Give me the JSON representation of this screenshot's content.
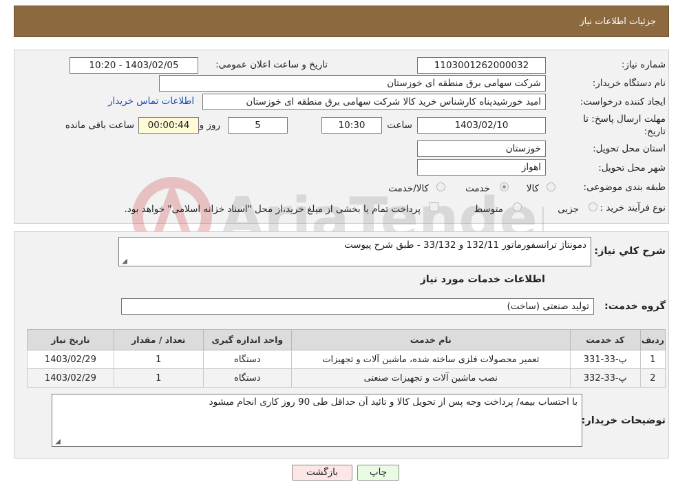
{
  "header": {
    "title": "جزئیات اطلاعات نیاز"
  },
  "info": {
    "need_number_label": "شماره نیاز:",
    "need_number": "1103001262000032",
    "announce_label": "تاریخ و ساعت اعلان عمومی:",
    "announce_value": "1403/02/05 - 10:20",
    "buyer_org_label": "نام دستگاه خریدار:",
    "buyer_org": "شرکت سهامی برق منطقه ای خوزستان",
    "requester_label": "ایجاد کننده درخواست:",
    "requester": "امید خورشیدپناه کارشناس خرید کالا شرکت سهامی برق منطقه ای خوزستان",
    "contact_link": "اطلاعات تماس خریدار",
    "deadline_label_1": "مهلت ارسال پاسخ: تا",
    "deadline_label_2": "تاریخ:",
    "deadline_date": "1403/02/10",
    "hour_label": "ساعت",
    "deadline_time": "10:30",
    "days_value": "5",
    "days_label": "روز و",
    "remaining_time": "00:00:44",
    "remaining_label": "ساعت باقی مانده",
    "province_label": "استان محل تحویل:",
    "province": "خوزستان",
    "city_label": "شهر محل تحویل:",
    "city": "اهواز",
    "category_label": "طبقه بندی موضوعی:",
    "category_options": [
      "کالا",
      "خدمت",
      "کالا/خدمت"
    ],
    "category_selected": "خدمت",
    "process_label": "نوع فرآیند خرید :",
    "process_options": [
      "جزیی",
      "متوسط"
    ],
    "payment_note": "پرداخت تمام یا بخشی از مبلغ خرید،از محل \"اسناد خزانه اسلامی\" خواهد بود."
  },
  "details": {
    "summary_label": "شرح کلي نياز:",
    "summary": "دمونتاژ ترانسفورماتور 132/11 و 33/132 - طبق شرح پیوست",
    "services_heading": "اطلاعات خدمات مورد نیاز",
    "group_label": "گروه خدمت:",
    "group_value": "تولید صنعتی (ساخت)",
    "table": {
      "headers": [
        "ردیف",
        "کد خدمت",
        "نام خدمت",
        "واحد اندازه گیری",
        "تعداد / مقدار",
        "تاریخ نیاز"
      ],
      "rows": [
        [
          "1",
          "پ-33-331",
          "تعمیر محصولات فلزی ساخته شده، ماشین آلات و تجهیزات",
          "دستگاه",
          "1",
          "1403/02/29"
        ],
        [
          "2",
          "پ-33-332",
          "نصب ماشین آلات و تجهیزات صنعتی",
          "دستگاه",
          "1",
          "1403/02/29"
        ]
      ]
    },
    "buyer_notes_label": "توضیحات خریدار:",
    "buyer_notes": "با احتساب بیمه/ پرداخت وجه پس از تحویل کالا و تائید آن حداقل طی 90 روز کاری انجام میشود"
  },
  "buttons": {
    "print": "چاپ",
    "back": "بازگشت"
  },
  "colors": {
    "header": "#8b6a3f",
    "print_btn": "#eafbe4",
    "back_btn": "#fde6e6"
  }
}
